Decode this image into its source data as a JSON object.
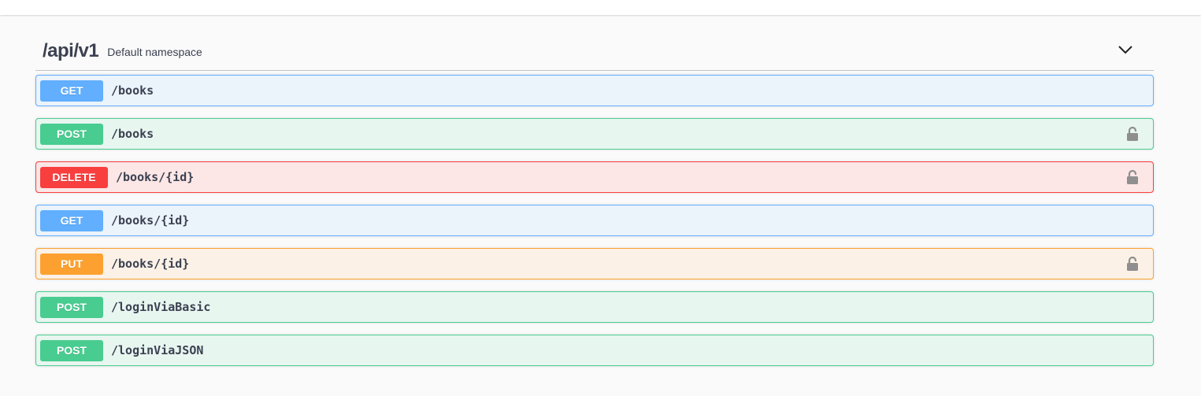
{
  "section": {
    "title": "/api/v1",
    "description": "Default namespace"
  },
  "colors": {
    "GET": {
      "badge": "#61affe",
      "bg": "#ebf3fb",
      "border": "#61affe"
    },
    "POST": {
      "badge": "#49cc90",
      "bg": "#e8f6f0",
      "border": "#49cc90"
    },
    "DELETE": {
      "badge": "#f93e3e",
      "bg": "#fce6e6",
      "border": "#f93e3e"
    },
    "PUT": {
      "badge": "#fca130",
      "bg": "#fbf1e6",
      "border": "#fca130"
    }
  },
  "operations": [
    {
      "method": "GET",
      "path": "/books",
      "locked": false
    },
    {
      "method": "POST",
      "path": "/books",
      "locked": true
    },
    {
      "method": "DELETE",
      "path": "/books/{id}",
      "locked": true
    },
    {
      "method": "GET",
      "path": "/books/{id}",
      "locked": false
    },
    {
      "method": "PUT",
      "path": "/books/{id}",
      "locked": true
    },
    {
      "method": "POST",
      "path": "/loginViaBasic",
      "locked": false
    },
    {
      "method": "POST",
      "path": "/loginViaJSON",
      "locked": false
    }
  ]
}
